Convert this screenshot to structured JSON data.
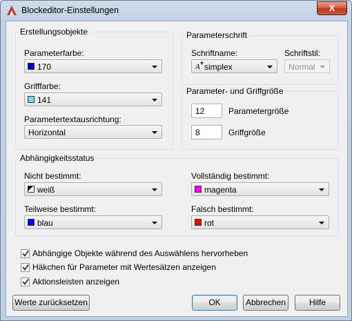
{
  "window": {
    "title": "Blockeditor-Einstellungen",
    "close_glyph": "X"
  },
  "erstellungsobjekte": {
    "title": "Erstellungsobjekte",
    "param_color": {
      "label": "Parameterfarbe:",
      "value": "170",
      "swatch": "#0000c8"
    },
    "grip_color": {
      "label": "Grifffarbe:",
      "value": "141",
      "swatch": "#7fd4f0"
    },
    "text_align": {
      "label": "Parametertextausrichtung:",
      "value": "Horizontal"
    }
  },
  "parameterschrift": {
    "title": "Parameterschrift",
    "font_name": {
      "label": "Schriftname:",
      "value": "simplex"
    },
    "font_style": {
      "label": "Schriftstil:",
      "value": "Normal"
    }
  },
  "groesse": {
    "title": "Parameter- und Griffgröße",
    "param_size": {
      "value": "12",
      "label": "Parametergröße"
    },
    "grip_size": {
      "value": "8",
      "label": "Griffgröße"
    }
  },
  "status": {
    "title": "Abhängigkeitsstatus",
    "nicht": {
      "label": "Nicht bestimmt:",
      "value": "weiß"
    },
    "voll": {
      "label": "Vollständig bestimmt:",
      "value": "magenta",
      "swatch": "#ff00ff"
    },
    "teil": {
      "label": "Teilweise bestimmt:",
      "value": "blau",
      "swatch": "#0000ff"
    },
    "falsch": {
      "label": "Falsch bestimmt:",
      "value": "rot",
      "swatch": "#ff0000"
    }
  },
  "checkboxes": [
    {
      "label": "Abhängige Objekte während des Auswählens hervorheben",
      "checked": true
    },
    {
      "label": "Häkchen für Parameter mit Wertesätzen anzeigen",
      "checked": true
    },
    {
      "label": "Aktionsleisten anzeigen",
      "checked": true
    }
  ],
  "buttons": {
    "reset": "Werte zurücksetzen",
    "ok": "OK",
    "cancel": "Abbrechen",
    "help": "Hilfe"
  }
}
